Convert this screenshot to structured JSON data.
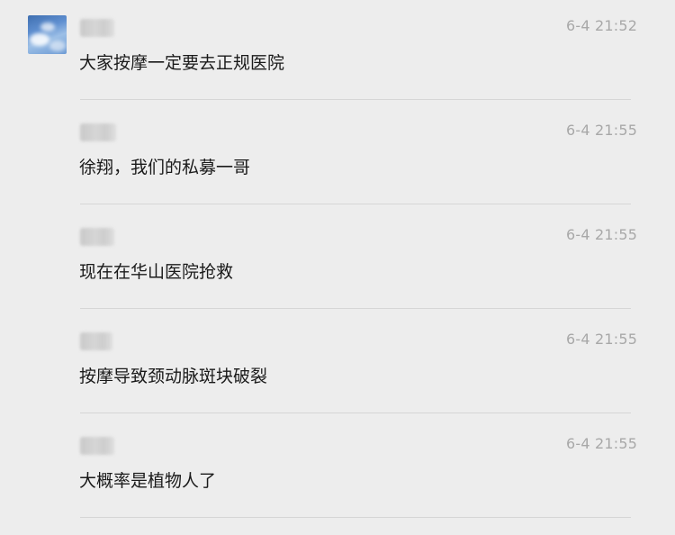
{
  "comments": [
    {
      "time": "6-4 21:52",
      "text": "大家按摩一定要去正规医院"
    },
    {
      "time": "6-4 21:55",
      "text": "徐翔，我们的私募一哥"
    },
    {
      "time": "6-4 21:55",
      "text": "现在在华山医院抢救"
    },
    {
      "time": "6-4 21:55",
      "text": "按摩导致颈动脉斑块破裂"
    },
    {
      "time": "6-4 21:55",
      "text": "大概率是植物人了"
    }
  ]
}
